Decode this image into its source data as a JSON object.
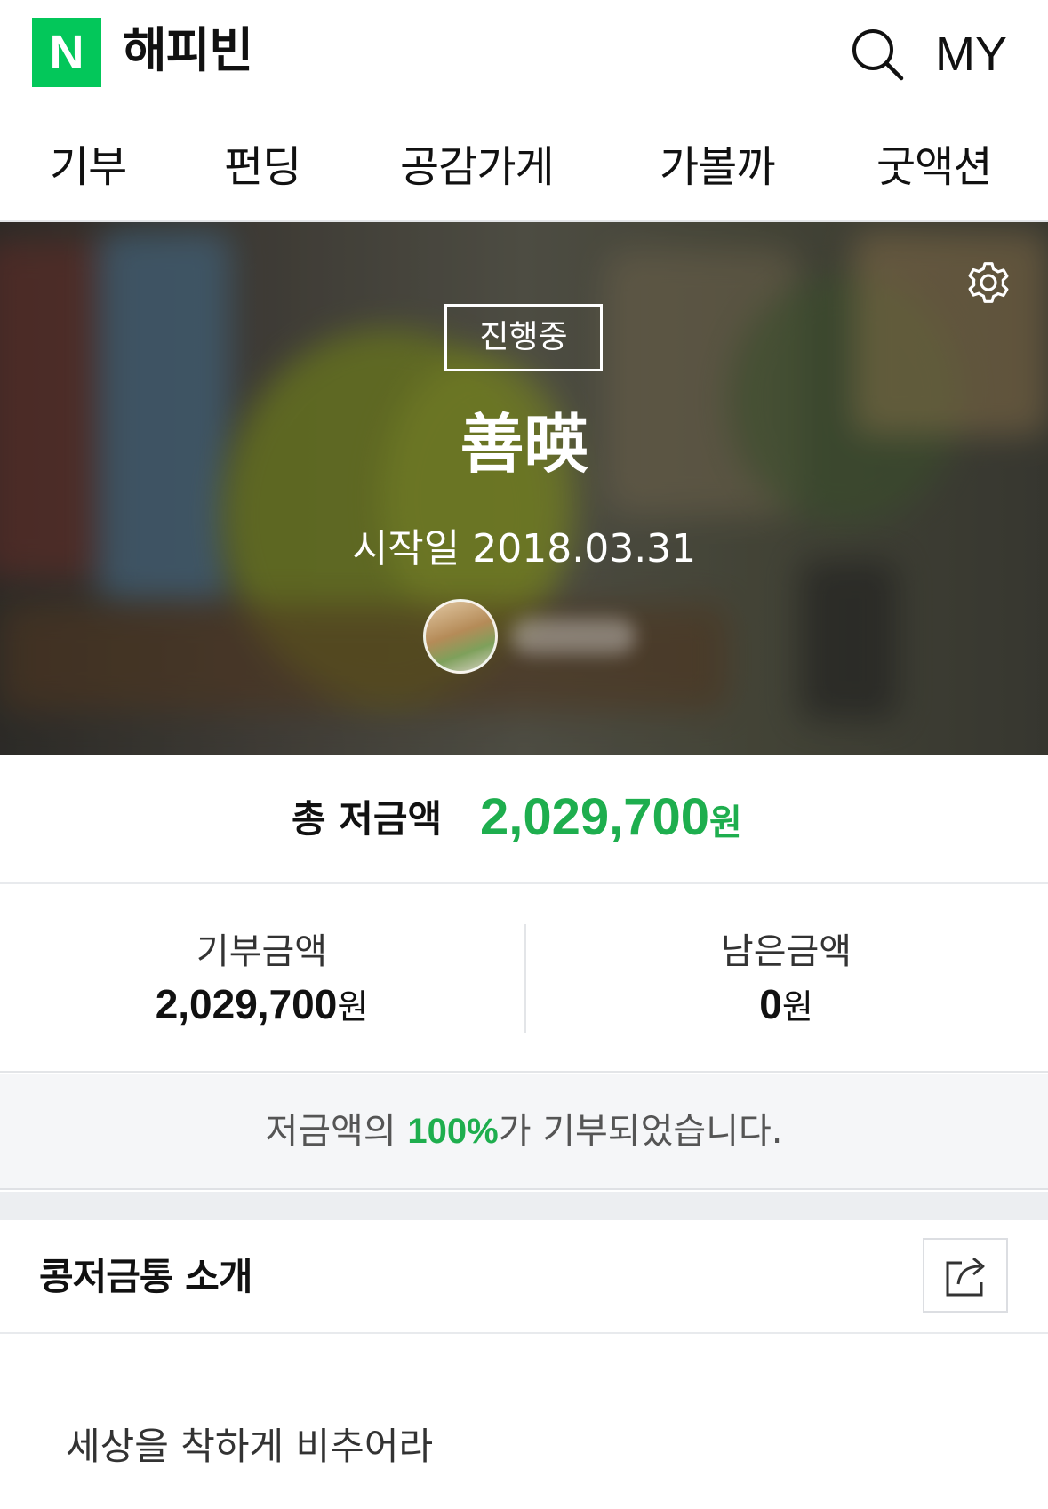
{
  "header": {
    "logo_letter": "N",
    "app_name": "해피빈",
    "my_label": "MY",
    "search_icon": "search-icon"
  },
  "nav": {
    "items": [
      {
        "label": "기부"
      },
      {
        "label": "펀딩"
      },
      {
        "label": "공감가게"
      },
      {
        "label": "가볼까"
      },
      {
        "label": "굿액션"
      }
    ]
  },
  "hero": {
    "status": "진행중",
    "title": "善暎",
    "start_date": "시작일 2018.03.31",
    "settings_icon": "gear-icon"
  },
  "summary": {
    "total_label": "총 저금액",
    "total_amount": "2,029,700",
    "total_unit": "원",
    "accent_color": "#1eae4e"
  },
  "stats": {
    "donated": {
      "label": "기부금액",
      "value": "2,029,700",
      "unit": "원"
    },
    "remaining": {
      "label": "남은금액",
      "value": "0",
      "unit": "원"
    }
  },
  "progress": {
    "prefix": "저금액의 ",
    "percent": "100%",
    "suffix": "가 기부되었습니다.",
    "value": 1.0
  },
  "intro": {
    "title": "콩저금통 소개",
    "share_icon": "share-icon",
    "text": "세상을 착하게 비추어라"
  }
}
